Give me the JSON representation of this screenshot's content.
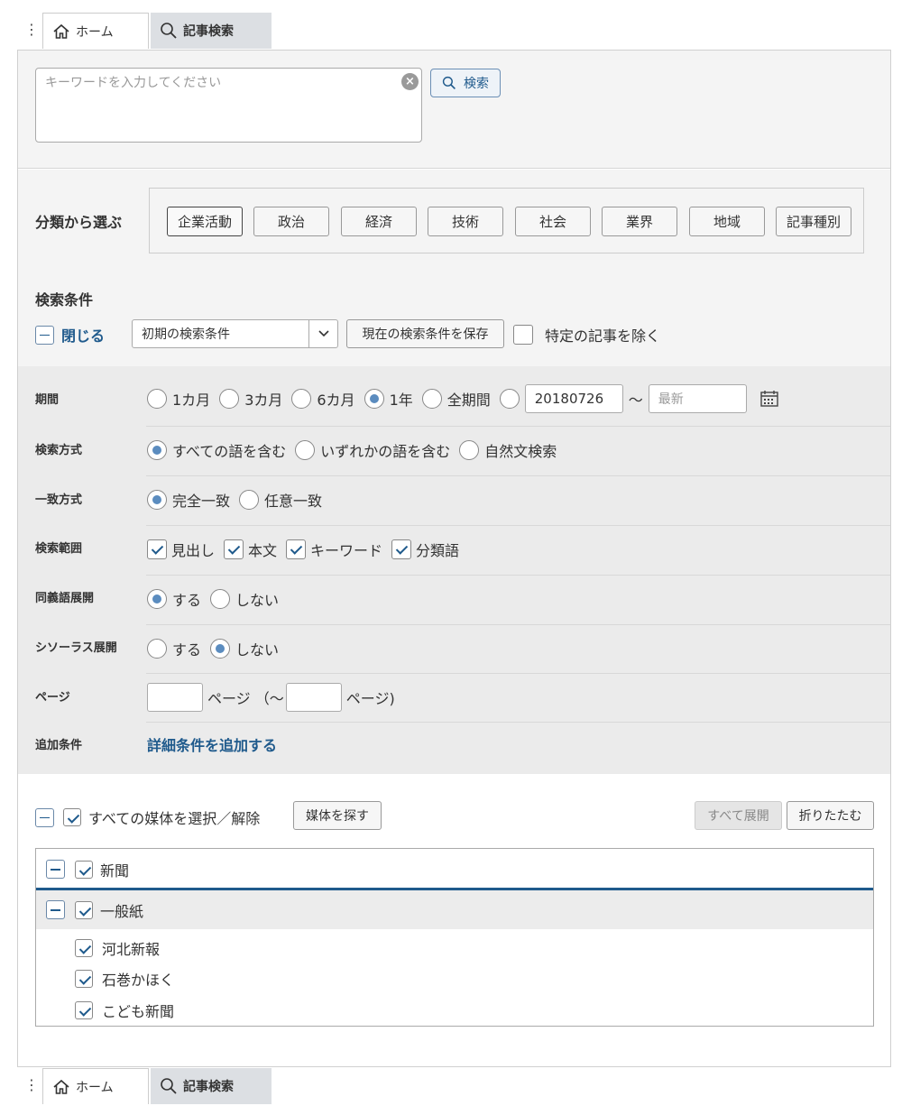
{
  "tabs": [
    {
      "label": "ホーム",
      "icon": "home-icon"
    },
    {
      "label": "記事検索",
      "icon": "search-icon"
    }
  ],
  "search": {
    "placeholder": "キーワードを入力してください",
    "button_label": "検索"
  },
  "category": {
    "title": "分類から選ぶ",
    "buttons": [
      "企業活動",
      "政治",
      "経済",
      "技術",
      "社会",
      "業界",
      "地域",
      "記事種別"
    ],
    "active": "企業活動"
  },
  "conditions": {
    "title": "検索条件",
    "close_label": "閉じる",
    "preset_value": "初期の検索条件",
    "save_label": "現在の検索条件を保存",
    "exclude_label": "特定の記事を除く",
    "rows": {
      "period": {
        "label": "期間",
        "options": [
          "1カ月",
          "3カ月",
          "6カ月",
          "1年",
          "全期間"
        ],
        "selected": "1年",
        "from": "20180726",
        "tilde": "～",
        "to_placeholder": "最新"
      },
      "method": {
        "label": "検索方式",
        "options": [
          "すべての語を含む",
          "いずれかの語を含む",
          "自然文検索"
        ],
        "selected": "すべての語を含む"
      },
      "match": {
        "label": "一致方式",
        "options": [
          "完全一致",
          "任意一致"
        ],
        "selected": "完全一致"
      },
      "scope": {
        "label": "検索範囲",
        "options": [
          "見出し",
          "本文",
          "キーワード",
          "分類語"
        ]
      },
      "synonym": {
        "label": "同義語展開",
        "options": [
          "する",
          "しない"
        ],
        "selected": "する"
      },
      "thesaurus": {
        "label": "シソーラス展開",
        "options": [
          "する",
          "しない"
        ],
        "selected": "しない"
      },
      "page": {
        "label": "ページ",
        "text1": "ページ （～",
        "text2": "ページ)"
      },
      "extra": {
        "label": "追加条件",
        "link": "詳細条件を追加する"
      }
    }
  },
  "media": {
    "select_all_label": "すべての媒体を選択／解除",
    "find_label": "媒体を探す",
    "expand_all_label": "すべて展開",
    "collapse_label": "折りたたむ",
    "group": "新聞",
    "subgroup": "一般紙",
    "items": [
      "河北新報",
      "石巻かほく",
      "こども新聞"
    ]
  },
  "colors": {
    "accent": "#1f5a8c",
    "radio_fill": "#5b8cbf"
  }
}
